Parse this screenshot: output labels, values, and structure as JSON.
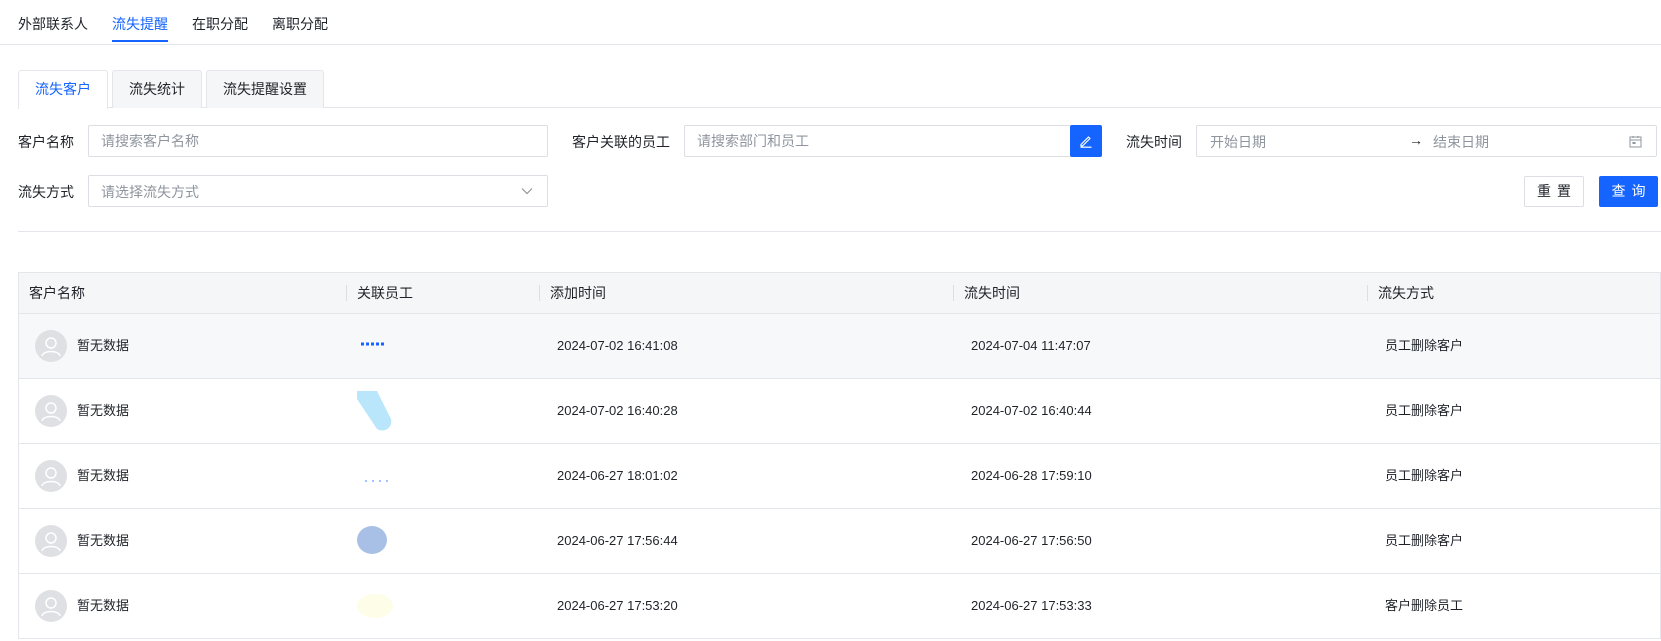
{
  "top_tabs": [
    {
      "label": "外部联系人",
      "active": false
    },
    {
      "label": "流失提醒",
      "active": true
    },
    {
      "label": "在职分配",
      "active": false
    },
    {
      "label": "离职分配",
      "active": false
    }
  ],
  "sub_tabs": [
    {
      "label": "流失客户",
      "active": true
    },
    {
      "label": "流失统计",
      "active": false
    },
    {
      "label": "流失提醒设置",
      "active": false
    }
  ],
  "filters": {
    "customer_name": {
      "label": "客户名称",
      "placeholder": "请搜索客户名称",
      "value": ""
    },
    "employee": {
      "label": "客户关联的员工",
      "placeholder": "请搜索部门和员工",
      "value": ""
    },
    "churn_time": {
      "label": "流失时间",
      "start_placeholder": "开始日期",
      "separator": "→",
      "end_placeholder": "结束日期"
    },
    "churn_method": {
      "label": "流失方式",
      "placeholder": "请选择流失方式"
    }
  },
  "buttons": {
    "reset": "重置",
    "query": "查询"
  },
  "table": {
    "columns": [
      "客户名称",
      "关联员工",
      "添加时间",
      "流失时间",
      "流失方式"
    ],
    "rows": [
      {
        "customer": "暂无数据",
        "add_time": "2024-07-02 16:41:08",
        "churn_time": "2024-07-04 11:47:07",
        "method": "员工删除客户"
      },
      {
        "customer": "暂无数据",
        "add_time": "2024-07-02 16:40:28",
        "churn_time": "2024-07-02 16:40:44",
        "method": "员工删除客户"
      },
      {
        "customer": "暂无数据",
        "add_time": "2024-06-27 18:01:02",
        "churn_time": "2024-06-28 17:59:10",
        "method": "员工删除客户"
      },
      {
        "customer": "暂无数据",
        "add_time": "2024-06-27 17:56:44",
        "churn_time": "2024-06-27 17:56:50",
        "method": "员工删除客户"
      },
      {
        "customer": "暂无数据",
        "add_time": "2024-06-27 17:53:20",
        "churn_time": "2024-06-27 17:53:33",
        "method": "客户删除员工"
      }
    ]
  },
  "colors": {
    "primary": "#1664ff",
    "border": "#e5e6eb",
    "header_bg": "#f5f6f7"
  },
  "icons": {
    "edit": "pencil-icon",
    "calendar": "calendar-icon",
    "dropdown": "chevron-down-icon",
    "avatar": "user-avatar-icon"
  }
}
